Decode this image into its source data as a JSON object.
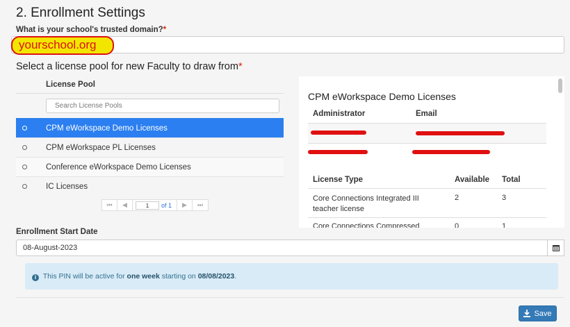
{
  "section_title": "2. Enrollment Settings",
  "domain": {
    "label": "What is your school's trusted domain?",
    "required_mark": "*",
    "value": "yourschool.org"
  },
  "license_pool": {
    "label": "Select a license pool for new Faculty to draw from",
    "required_mark": "*",
    "column_header": "License Pool",
    "search_placeholder": "Search License Pools",
    "items": [
      {
        "label": "CPM eWorkspace Demo Licenses",
        "selected": true
      },
      {
        "label": "CPM eWorkspace PL Licenses",
        "selected": false
      },
      {
        "label": "Conference eWorkspace Demo Licenses",
        "selected": false
      },
      {
        "label": "IC Licenses",
        "selected": false
      }
    ],
    "pager": {
      "page": "1",
      "of_text": "of 1"
    }
  },
  "detail": {
    "title": "CPM eWorkspace Demo Licenses",
    "admin_headers": {
      "administrator": "Administrator",
      "email": "Email"
    },
    "license_headers": {
      "type": "License Type",
      "available": "Available",
      "total": "Total"
    },
    "licenses": [
      {
        "type": "Core Connections Integrated III teacher license",
        "available": "2",
        "total": "3"
      },
      {
        "type": "Core Connections Compressed",
        "available": "0",
        "total": "1"
      }
    ]
  },
  "enrollment": {
    "label": "Enrollment Start Date",
    "date_value": "08-August-2023"
  },
  "alert": {
    "prefix": "This PIN will be active for",
    "duration": "one week",
    "middle": "starting on",
    "date": "08/08/2023",
    "suffix": "."
  },
  "save_label": "Save",
  "colors": {
    "accent": "#2b7ff0",
    "save_button": "#337ab7",
    "alert_bg": "#d9ebf7",
    "highlight": "#f2e600",
    "annotation_red": "#d11"
  }
}
